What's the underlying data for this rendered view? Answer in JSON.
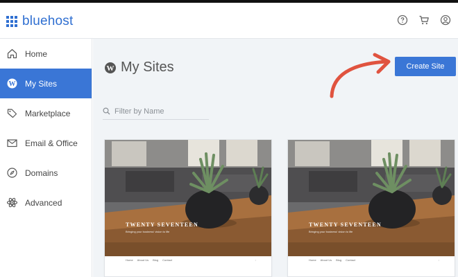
{
  "brand": {
    "name": "bluehost"
  },
  "header": {
    "icons": [
      "help-icon",
      "cart-icon",
      "account-icon"
    ]
  },
  "sidebar": {
    "items": [
      {
        "label": "Home",
        "icon": "home-icon"
      },
      {
        "label": "My Sites",
        "icon": "wordpress-icon",
        "active": true
      },
      {
        "label": "Marketplace",
        "icon": "tag-icon"
      },
      {
        "label": "Email & Office",
        "icon": "mail-icon"
      },
      {
        "label": "Domains",
        "icon": "compass-icon"
      },
      {
        "label": "Advanced",
        "icon": "atom-icon"
      }
    ]
  },
  "main": {
    "title": "My Sites",
    "create_button": "Create Site",
    "filter_placeholder": "Filter by Name"
  },
  "sites": [
    {
      "theme_title": "TWENTY SEVENTEEN",
      "tagline": "Bringing your business' vision to life",
      "menu": [
        "Home",
        "About Us",
        "Blog",
        "Contact"
      ]
    },
    {
      "theme_title": "TWENTY SEVENTEEN",
      "tagline": "Bringing your business' vision to life",
      "menu": [
        "Home",
        "About Us",
        "Blog",
        "Contact"
      ]
    }
  ],
  "colors": {
    "accent": "#3a76d6",
    "brand": "#2f6fd1",
    "annotation_arrow": "#e0533f",
    "main_bg": "#f1f4f7"
  }
}
